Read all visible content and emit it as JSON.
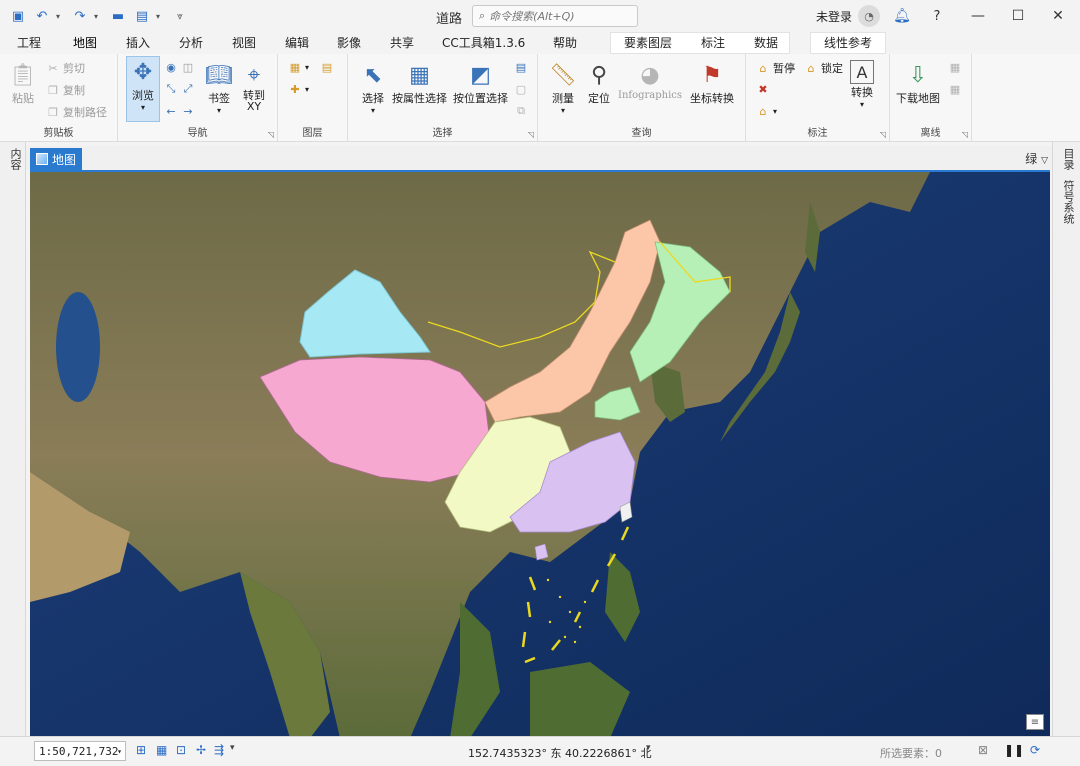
{
  "window": {
    "title": "道路",
    "login": "未登录"
  },
  "search": {
    "placeholder": "命令搜索(Alt+Q)"
  },
  "tabs": [
    "工程",
    "地图",
    "插入",
    "分析",
    "视图",
    "编辑",
    "影像",
    "共享",
    "CC工具箱1.3.6",
    "帮助",
    "要素图层",
    "标注",
    "数据",
    "线性参考"
  ],
  "active_tab": "地图",
  "ribbon": {
    "clipboard": {
      "label": "剪贴板",
      "paste": "粘贴",
      "cut": "剪切",
      "copy": "复制",
      "copy_path": "复制路径"
    },
    "navigate": {
      "label": "导航",
      "explore": "浏览",
      "bookmarks": "书签",
      "goto_xy": "转到\nXY"
    },
    "layer": {
      "label": "图层"
    },
    "selection": {
      "label": "选择",
      "select": "选择",
      "by_attribute": "按属性选择",
      "by_location": "按位置选择"
    },
    "inquiry": {
      "label": "查询",
      "measure": "测量",
      "locate": "定位",
      "infographics": "Infographics",
      "convert_coords": "坐标转换"
    },
    "labeling": {
      "label": "标注",
      "pause": "暂停",
      "lock": "锁定",
      "convert": "转换"
    },
    "offline": {
      "label": "离线",
      "download_map": "下载地图"
    }
  },
  "panes": {
    "left": "内容",
    "right_catalog": "目录",
    "right_symbology": "符号系统"
  },
  "view": {
    "tab": "地图",
    "right_label": "绿"
  },
  "status": {
    "scale": "1:50,721,732",
    "coords": "152.7435323° 东 40.2226861° 北",
    "selected": "所选要素：0"
  }
}
